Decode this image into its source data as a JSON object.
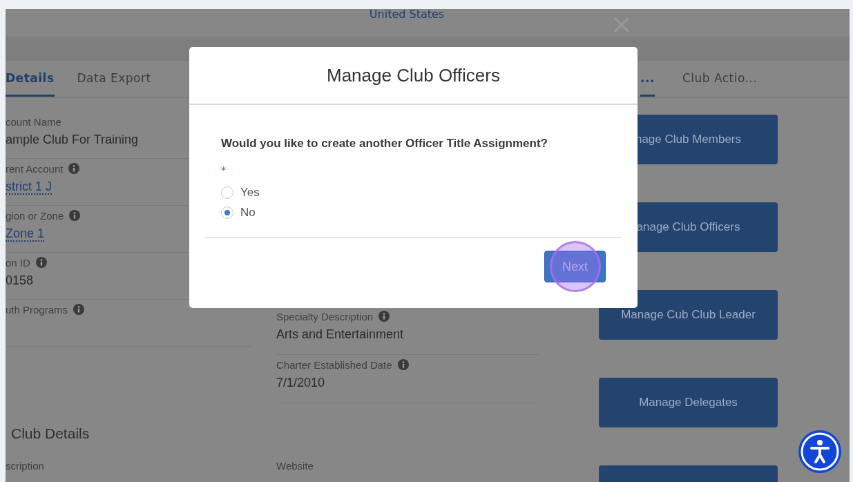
{
  "header": {
    "country": "United States"
  },
  "tabs_left": [
    {
      "label": "Details",
      "selected": true
    },
    {
      "label": "Data Export",
      "selected": false
    }
  ],
  "fields_left": [
    {
      "label": "count Name",
      "info": false,
      "value": "ample Club For Training",
      "link": false
    },
    {
      "label": "rent Account",
      "info": true,
      "value": "strict 1 J",
      "link": true
    },
    {
      "label": "gion or Zone",
      "info": true,
      "value": "Zone 1",
      "link": true
    },
    {
      "label": "on ID",
      "info": true,
      "value": "0158",
      "link": false
    },
    {
      "label": "uth Programs",
      "info": true
    }
  ],
  "fields_right": [
    {
      "label": "Specialty Description",
      "info": true,
      "value": "Arts and Entertainment",
      "link": false
    },
    {
      "label": "Charter Established Date",
      "info": true,
      "value": "7/1/2010",
      "link": false
    }
  ],
  "section": {
    "heading": "Club Details",
    "labels": [
      "scription",
      "Website"
    ]
  },
  "tabs_right": [
    {
      "label": "...",
      "selected": true
    },
    {
      "label": "Club Actio...",
      "selected": false
    }
  ],
  "actions": [
    {
      "kind": "button",
      "label": "nage Club Members"
    },
    {
      "kind": "button",
      "label": "anage Club Officers"
    },
    {
      "kind": "button",
      "label": "Manage Cub Club Leader"
    },
    {
      "kind": "button",
      "label": "Manage Delegates"
    },
    {
      "kind": "button"
    }
  ],
  "modal": {
    "title": "Manage Club Officers",
    "question": "Would you like to create another Officer Title Assignment?",
    "required_mark": "*",
    "options": [
      {
        "label": "Yes",
        "selected": false
      },
      {
        "label": "No",
        "selected": true
      }
    ],
    "button": "Next"
  }
}
